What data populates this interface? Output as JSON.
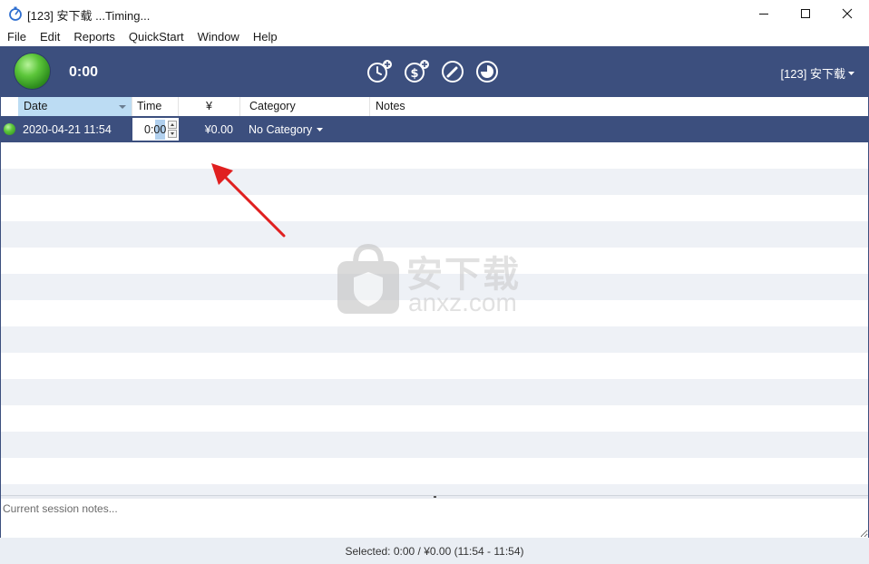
{
  "window": {
    "title": "[123] 安下载 ...Timing...",
    "minimize_glyph": "—",
    "maximize_glyph": "☐",
    "close_glyph": "✕"
  },
  "menu": [
    "File",
    "Edit",
    "Reports",
    "QuickStart",
    "Window",
    "Help"
  ],
  "toolbar": {
    "timer": "0:00",
    "project": "[123] 安下载",
    "buttons": [
      "clock-plus-icon",
      "dollar-plus-icon",
      "pencil-icon",
      "pie-chart-icon"
    ]
  },
  "table": {
    "columns": [
      "Date",
      "Time",
      "¥",
      "Category",
      "Notes"
    ],
    "rows": [
      {
        "date": "2020-04-21  11:54",
        "time": "0:00",
        "amount": "¥0.00",
        "category": "No Category",
        "notes": ""
      }
    ]
  },
  "watermark": {
    "cn": "安下载",
    "en": "anxz.com"
  },
  "notes": {
    "placeholder": "Current session notes..."
  },
  "status": {
    "text": "Selected: 0:00 / ¥0.00 (11:54 - 11:54)"
  },
  "colors": {
    "toolbar_bg": "#3c4f7e",
    "selected_row_bg": "#3c4f7e",
    "stripe_bg": "#eef1f6",
    "sorted_header_bg": "#bcdcf3",
    "annotation_arrow": "#e02020"
  }
}
